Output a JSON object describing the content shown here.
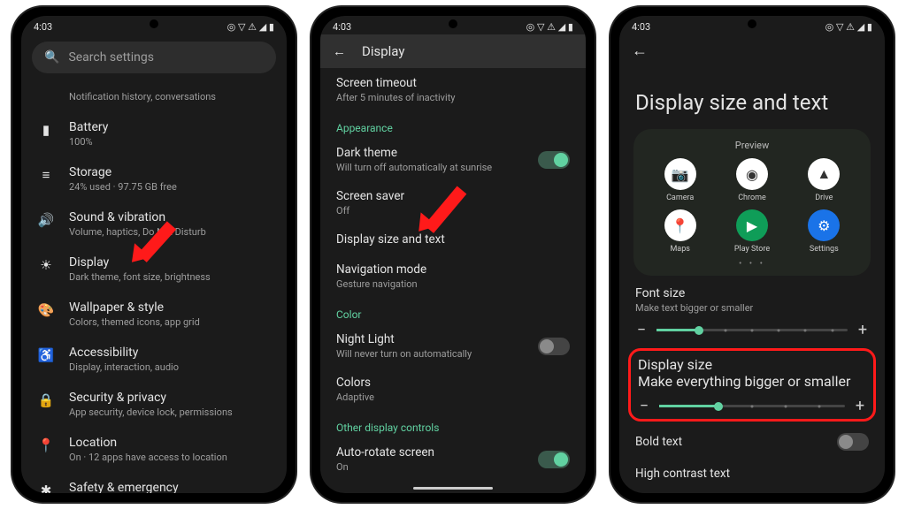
{
  "status": {
    "time": "4:03",
    "icons": "◎ ▽ ⚠ ◢ ▮"
  },
  "p1": {
    "search": "Search settings",
    "rows": [
      {
        "icon": "",
        "title": "",
        "sub": "Notification history, conversations"
      },
      {
        "icon": "▮",
        "title": "Battery",
        "sub": "100%"
      },
      {
        "icon": "≡",
        "title": "Storage",
        "sub": "24% used · 97.75 GB free"
      },
      {
        "icon": "🔊",
        "title": "Sound & vibration",
        "sub": "Volume, haptics, Do Not Disturb"
      },
      {
        "icon": "☀",
        "title": "Display",
        "sub": "Dark theme, font size, brightness"
      },
      {
        "icon": "🎨",
        "title": "Wallpaper & style",
        "sub": "Colors, themed icons, app grid"
      },
      {
        "icon": "♿",
        "title": "Accessibility",
        "sub": "Display, interaction, audio"
      },
      {
        "icon": "🔒",
        "title": "Security & privacy",
        "sub": "App security, device lock, permissions"
      },
      {
        "icon": "📍",
        "title": "Location",
        "sub": "On · 12 apps have access to location"
      },
      {
        "icon": "✱",
        "title": "Safety & emergency",
        "sub": ""
      }
    ]
  },
  "p2": {
    "header": "Display",
    "rows1": [
      {
        "t": "Screen timeout",
        "s": "After 5 minutes of inactivity"
      }
    ],
    "sec_appearance": "Appearance",
    "rows2": [
      {
        "t": "Dark theme",
        "s": "Will turn off automatically at sunrise",
        "tog": "on"
      },
      {
        "t": "Screen saver",
        "s": "Off"
      },
      {
        "t": "Display size and text",
        "s": ""
      },
      {
        "t": "Navigation mode",
        "s": "Gesture navigation"
      }
    ],
    "sec_color": "Color",
    "rows3": [
      {
        "t": "Night Light",
        "s": "Will never turn on automatically",
        "tog": "off"
      },
      {
        "t": "Colors",
        "s": "Adaptive"
      }
    ],
    "sec_other": "Other display controls",
    "rows4": [
      {
        "t": "Auto-rotate screen",
        "s": "On",
        "tog": "on"
      }
    ]
  },
  "p3": {
    "title": "Display size and text",
    "preview": "Preview",
    "apps": [
      {
        "name": "Camera",
        "bg": "#fff",
        "fg": "#333",
        "glyph": "📷"
      },
      {
        "name": "Chrome",
        "bg": "#fff",
        "fg": "#333",
        "glyph": "◉"
      },
      {
        "name": "Drive",
        "bg": "#fff",
        "fg": "#333",
        "glyph": "▲"
      },
      {
        "name": "Maps",
        "bg": "#fff",
        "fg": "#333",
        "glyph": "📍"
      },
      {
        "name": "Play Store",
        "bg": "#0f9d58",
        "fg": "#fff",
        "glyph": "▶"
      },
      {
        "name": "Settings",
        "bg": "#1a73e8",
        "fg": "#fff",
        "glyph": "⚙"
      }
    ],
    "font": {
      "t": "Font size",
      "s": "Make text bigger or smaller",
      "pct": 22
    },
    "display": {
      "t": "Display size",
      "s": "Make everything bigger or smaller",
      "pct": 32
    },
    "bold": "Bold text",
    "contrast": "High contrast text"
  }
}
